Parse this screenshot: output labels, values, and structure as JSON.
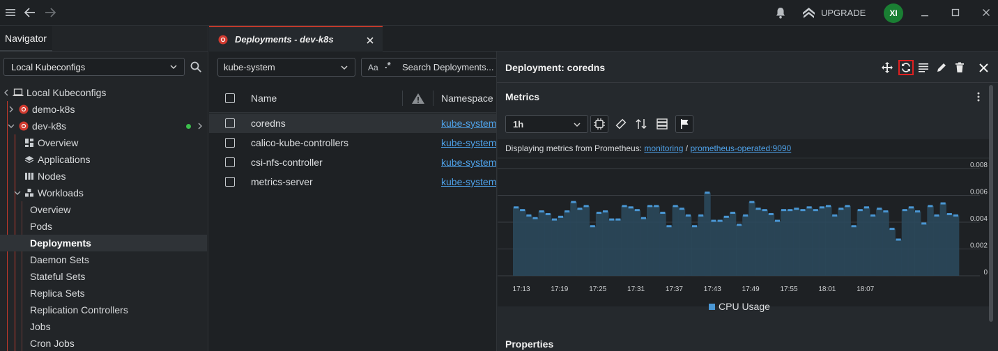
{
  "titlebar": {
    "upgrade_label": "UPGRADE",
    "avatar_initials": "XI"
  },
  "navigator": {
    "tab_label": "Navigator",
    "kubeconfig_select": "Local Kubeconfigs",
    "tree": {
      "root": "Local Kubeconfigs",
      "cluster1": "demo-k8s",
      "cluster2": "dev-k8s",
      "overview": "Overview",
      "applications": "Applications",
      "nodes": "Nodes",
      "workloads": "Workloads",
      "wl_overview": "Overview",
      "pods": "Pods",
      "deployments": "Deployments",
      "daemon_sets": "Daemon Sets",
      "stateful_sets": "Stateful Sets",
      "replica_sets": "Replica Sets",
      "replication_controllers": "Replication Controllers",
      "jobs": "Jobs",
      "cron_jobs": "Cron Jobs"
    }
  },
  "main": {
    "tab_label": "Deployments - dev-k8s",
    "namespace_select": "kube-system",
    "search_case_label": "Aa",
    "search_regex_label": ".*",
    "search_placeholder": "Search Deployments...",
    "columns": {
      "name": "Name",
      "namespace": "Namespace"
    },
    "rows": [
      {
        "name": "coredns",
        "namespace": "kube-system"
      },
      {
        "name": "calico-kube-controllers",
        "namespace": "kube-system"
      },
      {
        "name": "csi-nfs-controller",
        "namespace": "kube-system"
      },
      {
        "name": "metrics-server",
        "namespace": "kube-system"
      }
    ]
  },
  "details": {
    "title": "Deployment: coredns",
    "metrics_title": "Metrics",
    "range_select": "1h",
    "prom_prefix": "Displaying metrics from Prometheus: ",
    "prom_link1": "monitoring",
    "prom_sep": " / ",
    "prom_link2": "prometheus-operated:9090",
    "legend_label": "CPU Usage",
    "properties_title": "Properties"
  },
  "colors": {
    "accent_red": "#c0392b",
    "series_blue": "#4a97d4",
    "status_green": "#3cbf4c"
  },
  "chart_data": {
    "type": "bar",
    "title": "",
    "series": [
      {
        "name": "CPU Usage",
        "values": [
          0.0051,
          0.0049,
          0.0045,
          0.0043,
          0.0048,
          0.0046,
          0.0042,
          0.0044,
          0.0048,
          0.0055,
          0.005,
          0.0052,
          0.0037,
          0.0047,
          0.0048,
          0.0042,
          0.0042,
          0.0052,
          0.0051,
          0.0049,
          0.0043,
          0.0052,
          0.0052,
          0.0047,
          0.0037,
          0.0052,
          0.005,
          0.0045,
          0.0037,
          0.0045,
          0.0062,
          0.0041,
          0.0041,
          0.0044,
          0.0047,
          0.0038,
          0.0045,
          0.0055,
          0.005,
          0.0049,
          0.0046,
          0.0041,
          0.0049,
          0.0049,
          0.005,
          0.0049,
          0.0051,
          0.0049,
          0.0051,
          0.0052,
          0.0045,
          0.005,
          0.0052,
          0.0037,
          0.0049,
          0.0051,
          0.0045,
          0.005,
          0.0048,
          0.0035,
          0.0027,
          0.0049,
          0.0051,
          0.0048,
          0.0039,
          0.0052,
          0.0045,
          0.0054,
          0.0046,
          0.0045
        ]
      }
    ],
    "x_tick_labels": [
      "17:13",
      "17:19",
      "17:25",
      "17:31",
      "17:37",
      "17:43",
      "17:49",
      "17:55",
      "18:01",
      "18:07"
    ],
    "y_tick_labels": [
      "0",
      "0.002",
      "0.004",
      "0.006",
      "0.008"
    ],
    "ylim": [
      0,
      0.008
    ],
    "grid": true,
    "legend": "bottom-center"
  }
}
